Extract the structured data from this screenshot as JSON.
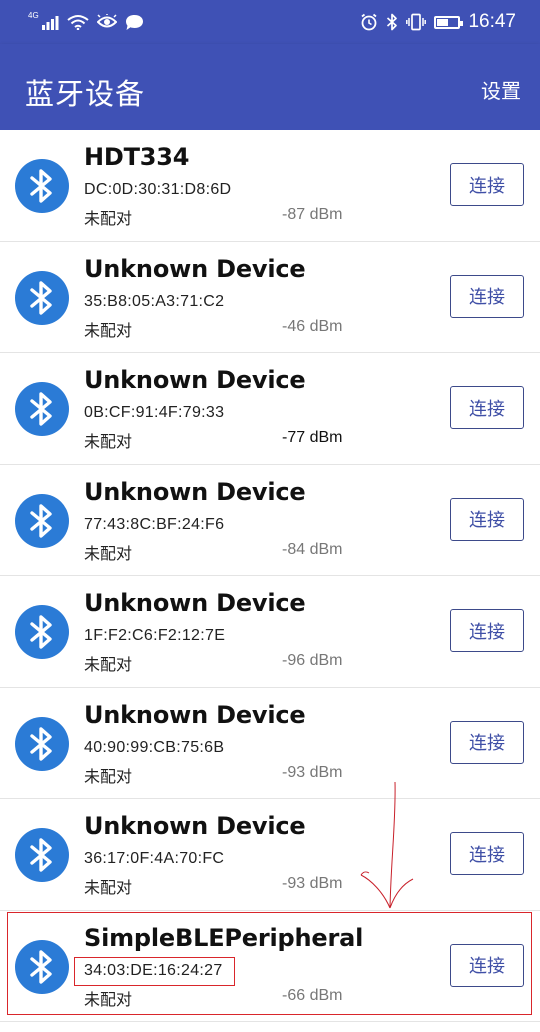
{
  "status_bar": {
    "network": "4G",
    "time": "16:47",
    "battery_level": 0.55
  },
  "app": {
    "title": "蓝牙设备",
    "settings_label": "设置"
  },
  "devices": [
    {
      "name": "HDT334",
      "address": "DC:0D:30:31:D8:6D",
      "status": "未配对",
      "rssi": "-87 dBm",
      "connect_label": "连接"
    },
    {
      "name": "Unknown Device",
      "address": "35:B8:05:A3:71:C2",
      "status": "未配对",
      "rssi": "-46 dBm",
      "connect_label": "连接"
    },
    {
      "name": "Unknown Device",
      "address": "0B:CF:91:4F:79:33",
      "status": "未配对",
      "rssi": "-77 dBm",
      "connect_label": "连接"
    },
    {
      "name": "Unknown Device",
      "address": "77:43:8C:BF:24:F6",
      "status": "未配对",
      "rssi": "-84 dBm",
      "connect_label": "连接"
    },
    {
      "name": "Unknown Device",
      "address": "1F:F2:C6:F2:12:7E",
      "status": "未配对",
      "rssi": "-96 dBm",
      "connect_label": "连接"
    },
    {
      "name": "Unknown Device",
      "address": "40:90:99:CB:75:6B",
      "status": "未配对",
      "rssi": "-93 dBm",
      "connect_label": "连接"
    },
    {
      "name": "Unknown Device",
      "address": "36:17:0F:4A:70:FC",
      "status": "未配对",
      "rssi": "-93 dBm",
      "connect_label": "连接"
    },
    {
      "name": "SimpleBLEPeripheral",
      "address": "34:03:DE:16:24:27",
      "status": "未配对",
      "rssi": "-66 dBm",
      "connect_label": "连接"
    }
  ],
  "icons": {
    "row_icon": "bluetooth-icon",
    "status_left": [
      "network-signal-icon",
      "wifi-icon",
      "eye-icon",
      "chat-icon"
    ],
    "status_right": [
      "alarm-icon",
      "bluetooth-icon",
      "vibrate-icon",
      "battery-icon"
    ]
  },
  "colors": {
    "appbar": "#3f51b5",
    "bluetooth_icon": "#2b7bd6",
    "connect_text": "#3f4fa6",
    "annotation": "#d9262b"
  }
}
